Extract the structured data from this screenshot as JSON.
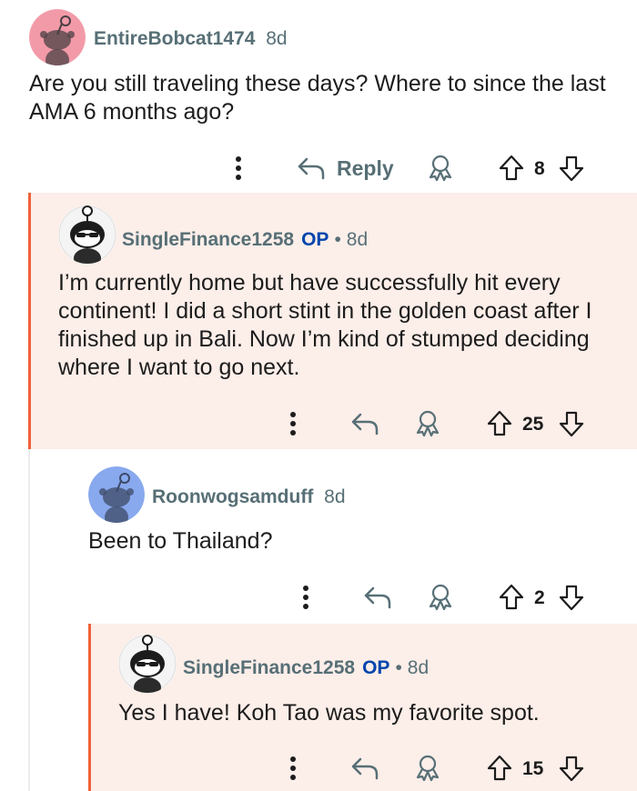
{
  "comments": [
    {
      "username": "EntireBobcat1474",
      "age": "8d",
      "text": "Are you still traveling these days? Where to since the last AMA 6 months ago?",
      "reply_label": "Reply",
      "votes": "8",
      "avatar_color": "#f39aa8"
    },
    {
      "username": "SingleFinance1258",
      "op_badge": "OP",
      "separator": "•",
      "age": "8d",
      "text": "I’m currently home but have successfully hit every continent! I did a short stint in the golden coast after I finished up in Bali. Now I’m kind of stumped deciding where I want to go next.",
      "votes": "25"
    },
    {
      "username": "Roonwogsamduff",
      "age": "8d",
      "text": "Been to Thailand?",
      "votes": "2",
      "avatar_color": "#88a9ee"
    },
    {
      "username": "SingleFinance1258",
      "op_badge": "OP",
      "separator": "•",
      "age": "8d",
      "text": "Yes I have! Koh Tao was my favorite spot.",
      "votes": "15"
    }
  ],
  "colors": {
    "highlight_background": "#fceee9",
    "thread_accent": "#f0613a",
    "op_blue": "#0045ac",
    "meta_gray": "#576f76"
  },
  "icons": [
    "more-options-icon",
    "reply-arrow-icon",
    "award-icon",
    "upvote-icon",
    "downvote-icon",
    "snoo-avatar-icon"
  ]
}
